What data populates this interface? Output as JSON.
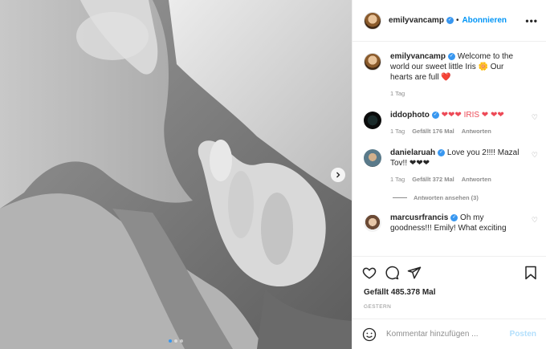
{
  "header": {
    "username": "emilyvancamp",
    "separator": "•",
    "follow_label": "Abonnieren",
    "more_icon": "more-horizontal-icon"
  },
  "caption": {
    "username": "emilyvancamp",
    "text": "Welcome to the world our sweet little Iris 🌼 Our hearts are full ❤️",
    "time": "1 Tag"
  },
  "comments": [
    {
      "username": "iddophoto",
      "text": "❤❤❤ IRIS ❤ ❤❤",
      "time": "1 Tag",
      "likes": "Gefällt 176 Mal",
      "reply_label": "Antworten"
    },
    {
      "username": "danielaruah",
      "text": "Love you 2!!!! Mazal Tov!! ❤❤❤",
      "time": "1 Tag",
      "likes": "Gefällt 372 Mal",
      "reply_label": "Antworten",
      "view_replies": "Antworten ansehen (3)"
    },
    {
      "username": "marcusrfrancis",
      "text": "Oh my goodness!!! Emily! What exciting"
    }
  ],
  "actions": {
    "likes": "Gefällt 485.378 Mal",
    "date": "GESTERN"
  },
  "composer": {
    "placeholder": "Kommentar hinzufügen ...",
    "post_label": "Posten"
  },
  "carousel": {
    "slide_count": 3,
    "active_index": 0
  },
  "colors": {
    "accent": "#0095f6",
    "heart": "#ed4956",
    "muted": "#8e8e8e"
  }
}
